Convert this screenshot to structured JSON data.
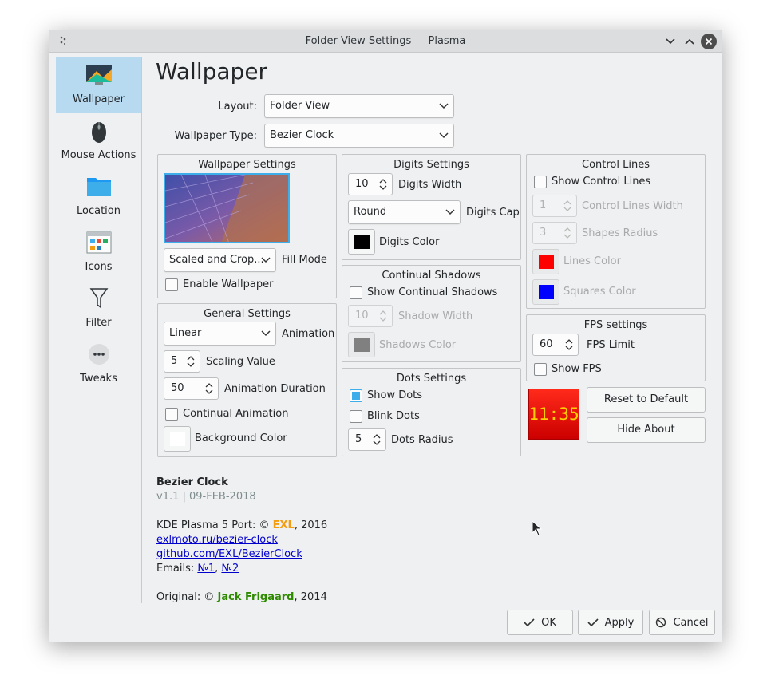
{
  "window": {
    "title": "Folder View Settings — Plasma"
  },
  "sidebar": {
    "items": [
      {
        "label": "Wallpaper",
        "icon": "wallpaper-icon",
        "active": true
      },
      {
        "label": "Mouse Actions",
        "icon": "mouse-icon"
      },
      {
        "label": "Location",
        "icon": "folder-icon"
      },
      {
        "label": "Icons",
        "icon": "icons-icon"
      },
      {
        "label": "Filter",
        "icon": "filter-icon"
      },
      {
        "label": "Tweaks",
        "icon": "tweaks-icon"
      }
    ]
  },
  "page": {
    "title": "Wallpaper",
    "layout_label": "Layout:",
    "layout_value": "Folder View",
    "type_label": "Wallpaper Type:",
    "type_value": "Bezier Clock"
  },
  "wallpaper_settings": {
    "title": "Wallpaper Settings",
    "fill_mode_value": "Scaled and Crop...",
    "fill_mode_label": "Fill Mode",
    "enable_label": "Enable Wallpaper"
  },
  "general_settings": {
    "title": "General Settings",
    "animation_value": "Linear",
    "animation_label": "Animation",
    "scaling_value": "5",
    "scaling_label": "Scaling Value",
    "duration_value": "50",
    "duration_label": "Animation Duration",
    "continual_label": "Continual Animation",
    "background_color_label": "Background Color"
  },
  "digits_settings": {
    "title": "Digits Settings",
    "width_value": "10",
    "width_label": "Digits Width",
    "cap_value": "Round",
    "cap_label": "Digits Cap",
    "color_label": "Digits Color"
  },
  "continual_shadows": {
    "title": "Continual Shadows",
    "show_label": "Show Continual Shadows",
    "width_value": "10",
    "width_label": "Shadow Width",
    "color_label": "Shadows Color"
  },
  "dots_settings": {
    "title": "Dots Settings",
    "show_label": "Show Dots",
    "show_checked": true,
    "blink_label": "Blink Dots",
    "radius_value": "5",
    "radius_label": "Dots Radius"
  },
  "control_lines": {
    "title": "Control Lines",
    "show_label": "Show Control Lines",
    "width_value": "1",
    "width_label": "Control Lines Width",
    "radius_value": "3",
    "radius_label": "Shapes Radius",
    "lines_color_label": "Lines Color",
    "squares_color_label": "Squares Color"
  },
  "fps_settings": {
    "title": "FPS settings",
    "limit_value": "60",
    "limit_label": "FPS Limit",
    "show_label": "Show FPS"
  },
  "clock_preview": {
    "time": "11:35"
  },
  "buttons": {
    "reset": "Reset to Default",
    "hide_about": "Hide About",
    "ok": "OK",
    "apply": "Apply",
    "cancel": "Cancel"
  },
  "about": {
    "name": "Bezier Clock",
    "version": "v1.1 | 09-FEB-2018",
    "port_prefix": "KDE Plasma 5 Port: © ",
    "port_author": "EXL",
    "port_suffix": ", 2016",
    "link1": "exlmoto.ru/bezier-clock",
    "link2": "github.com/EXL/BezierClock",
    "emails_prefix": "Emails: ",
    "email1": "№1",
    "email_sep": ", ",
    "email2": "№2",
    "original_prefix": "Original: © ",
    "original_author": "Jack Frigaard",
    "original_suffix": ", 2014"
  },
  "colors": {
    "accent": "#3daee9",
    "digits_color": "#000000",
    "background_color": "#ffffff",
    "shadows_color": "#808080",
    "lines_color": "#ff0000",
    "squares_color": "#0000ff",
    "exl_color": "#f39c12",
    "author_color": "#2e8b00"
  }
}
